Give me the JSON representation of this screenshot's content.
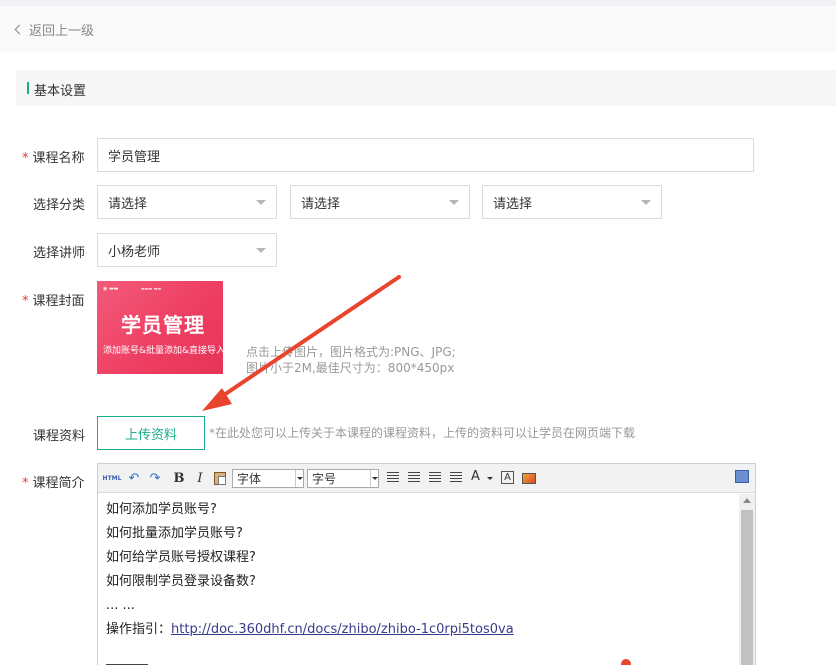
{
  "nav": {
    "back_label": "返回上一级"
  },
  "section": {
    "title": "基本设置"
  },
  "form": {
    "course_name": {
      "label": "课程名称",
      "required": "*",
      "value": "学员管理"
    },
    "category": {
      "label": "选择分类",
      "selects": [
        "请选择",
        "请选择",
        "请选择"
      ]
    },
    "lecturer": {
      "label": "选择讲师",
      "value": "小杨老师"
    },
    "cover": {
      "label": "课程封面",
      "required": "*",
      "image_title": "学员管理",
      "image_subtitle": "添加账号&批量添加&直接导入",
      "hint_line1": "点击上传图片，图片格式为:PNG、JPG;",
      "hint_line2": "图片小于2M,最佳尺寸为：800*450px"
    },
    "materials": {
      "label": "课程资料",
      "button": "上传资料",
      "hint": "*在此处您可以上传关于本课程的课程资料，上传的资料可以让学员在网页端下载"
    },
    "intro": {
      "label": "课程简介",
      "required": "*",
      "toolbar": {
        "html": "HTML",
        "undo": "↶",
        "redo": "↷",
        "bold": "B",
        "italic": "I",
        "font_family": "字体",
        "font_size": "字号",
        "font_color": "A",
        "bg_color": "A"
      },
      "lines": [
        "如何添加学员账号?",
        "如何批量添加学员账号?",
        "如何给学员账号授权课程?",
        "如何限制学员登录设备数?",
        "... ..."
      ],
      "guide_label": "操作指引：",
      "guide_link": "http://doc.360dhf.cn/docs/zhibo/zhibo-1c0rpi5tos0va"
    }
  },
  "colors": {
    "accent": "#1aad8c",
    "required": "#e53935",
    "annotation_arrow": "#e8442e"
  }
}
